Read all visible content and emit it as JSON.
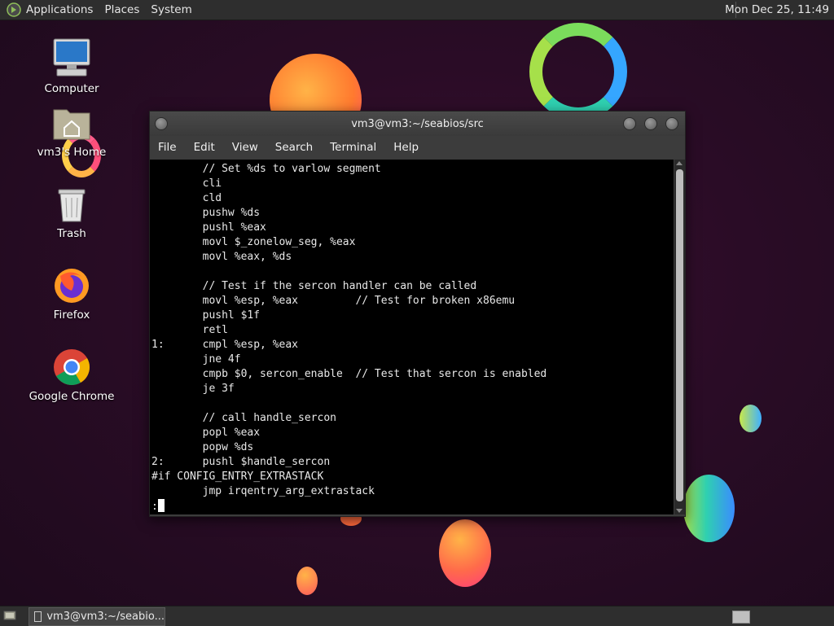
{
  "top_panel": {
    "menus": [
      "Applications",
      "Places",
      "System"
    ],
    "clock": "Mon Dec 25, 11:49"
  },
  "desktop_icons": [
    {
      "label": "Computer",
      "icon": "computer-icon"
    },
    {
      "label": "vm3's Home",
      "icon": "home-folder-icon"
    },
    {
      "label": "Trash",
      "icon": "trash-icon"
    },
    {
      "label": "Firefox",
      "icon": "firefox-icon"
    },
    {
      "label": "Google Chrome",
      "icon": "chrome-icon"
    }
  ],
  "terminal": {
    "title": "vm3@vm3:~/seabios/src",
    "menu": [
      "File",
      "Edit",
      "View",
      "Search",
      "Terminal",
      "Help"
    ],
    "lines": [
      "        // Set %ds to varlow segment",
      "        cli",
      "        cld",
      "        pushw %ds",
      "        pushl %eax",
      "        movl $_zonelow_seg, %eax",
      "        movl %eax, %ds",
      "",
      "        // Test if the sercon handler can be called",
      "        movl %esp, %eax         // Test for broken x86emu",
      "        pushl $1f",
      "        retl",
      "1:      cmpl %esp, %eax",
      "        jne 4f",
      "        cmpb $0, sercon_enable  // Test that sercon is enabled",
      "        je 3f",
      "",
      "        // call handle_sercon",
      "        popl %eax",
      "        popw %ds",
      "2:      pushl $handle_sercon",
      "#if CONFIG_ENTRY_EXTRASTACK",
      "        jmp irqentry_arg_extrastack"
    ],
    "prompt": ":"
  },
  "taskbar": {
    "window_button": "vm3@vm3:~/seabio..."
  },
  "colors": {
    "desktop_bg": "#2a0c26",
    "panel_bg": "#2e2e2e",
    "terminal_bg": "#000000",
    "terminal_fg": "#e8e8e8"
  }
}
